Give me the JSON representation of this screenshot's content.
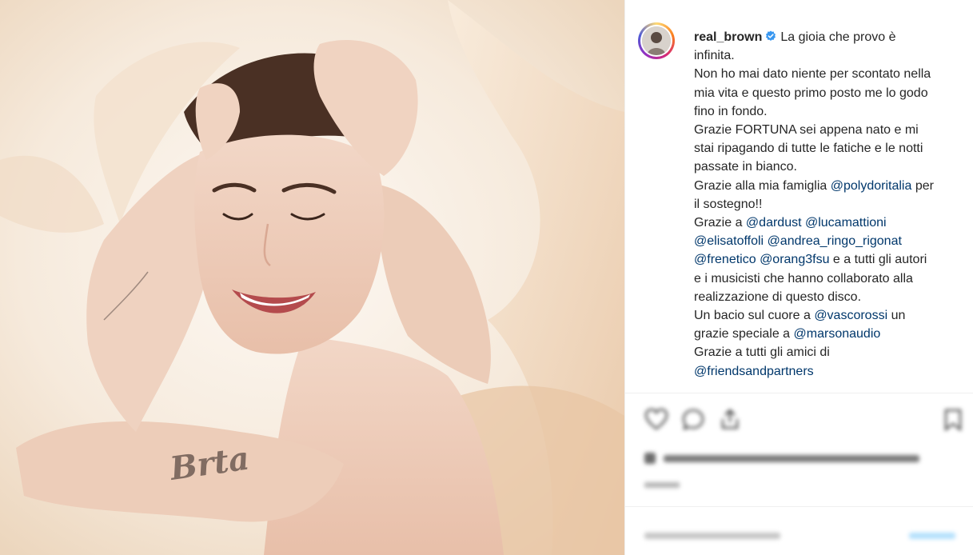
{
  "post": {
    "username": "real_brown",
    "verified": true,
    "caption_lines": [
      "La gioia che provo è",
      "infinita.",
      "Non ho mai dato niente per scontato nella",
      "mia vita e questo primo posto me lo godo",
      "fino in fondo.",
      "Grazie FORTUNA sei appena nato e mi",
      "stai ripagando di tutte le fatiche e le notti",
      "passate in bianco.",
      "Grazie alla mia famiglia",
      "@polydoritalia",
      "per",
      "il sostegno!!",
      "Grazie a",
      "@dardust",
      "@lucamattioni",
      "@elisatoffoli",
      "@andrea_ringo_rigonat",
      "@frenetico",
      "@orang3fsu",
      "e a tutti gli autori",
      "e i musicisti che hanno collaborato alla",
      "realizzazione di questo disco.",
      "Un bacio sul cuore a",
      "@vascorossi",
      "un",
      "grazie speciale a",
      "@marsonaudio",
      "Grazie a tutti gli amici di",
      "@friendsandpartners"
    ]
  },
  "photo": {
    "tattoo_text": "Brta"
  },
  "actions": {
    "icons": [
      "heart-icon",
      "comment-icon",
      "share-icon",
      "bookmark-icon"
    ]
  },
  "colors": {
    "mention": "#00376b",
    "verified": "#3897f0",
    "text": "#262626",
    "divider": "#efefef",
    "photo_bg": "#f4e6d7"
  }
}
